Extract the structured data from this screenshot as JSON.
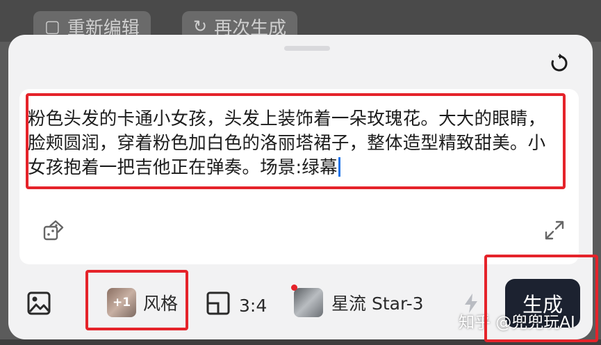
{
  "background": {
    "re_edit_label": "重新编辑",
    "regenerate_label": "再次生成"
  },
  "prompt": {
    "text": "粉色头发的卡通小女孩，头发上装饰着一朵玫瑰花。大大的眼睛，脸颊圆润，穿着粉色加白色的洛丽塔裙子，整体造型精致甜美。小女孩抱着一把吉他正在弹奏。场景:绿幕"
  },
  "toolbar": {
    "style_badge": "+1",
    "style_label": "风格",
    "ratio_label": "3:4",
    "model_label": "星流 Star-3",
    "generate_label": "生成"
  },
  "watermark": "知乎 @兜兜玩AI",
  "colors": {
    "highlight": "#e5232a",
    "generate_button": "#1c2230",
    "caret": "#1a73e8"
  },
  "icons": [
    "refresh-icon",
    "dice-icon",
    "expand-icon",
    "image-upload-icon",
    "aspect-ratio-icon",
    "lightning-icon"
  ]
}
